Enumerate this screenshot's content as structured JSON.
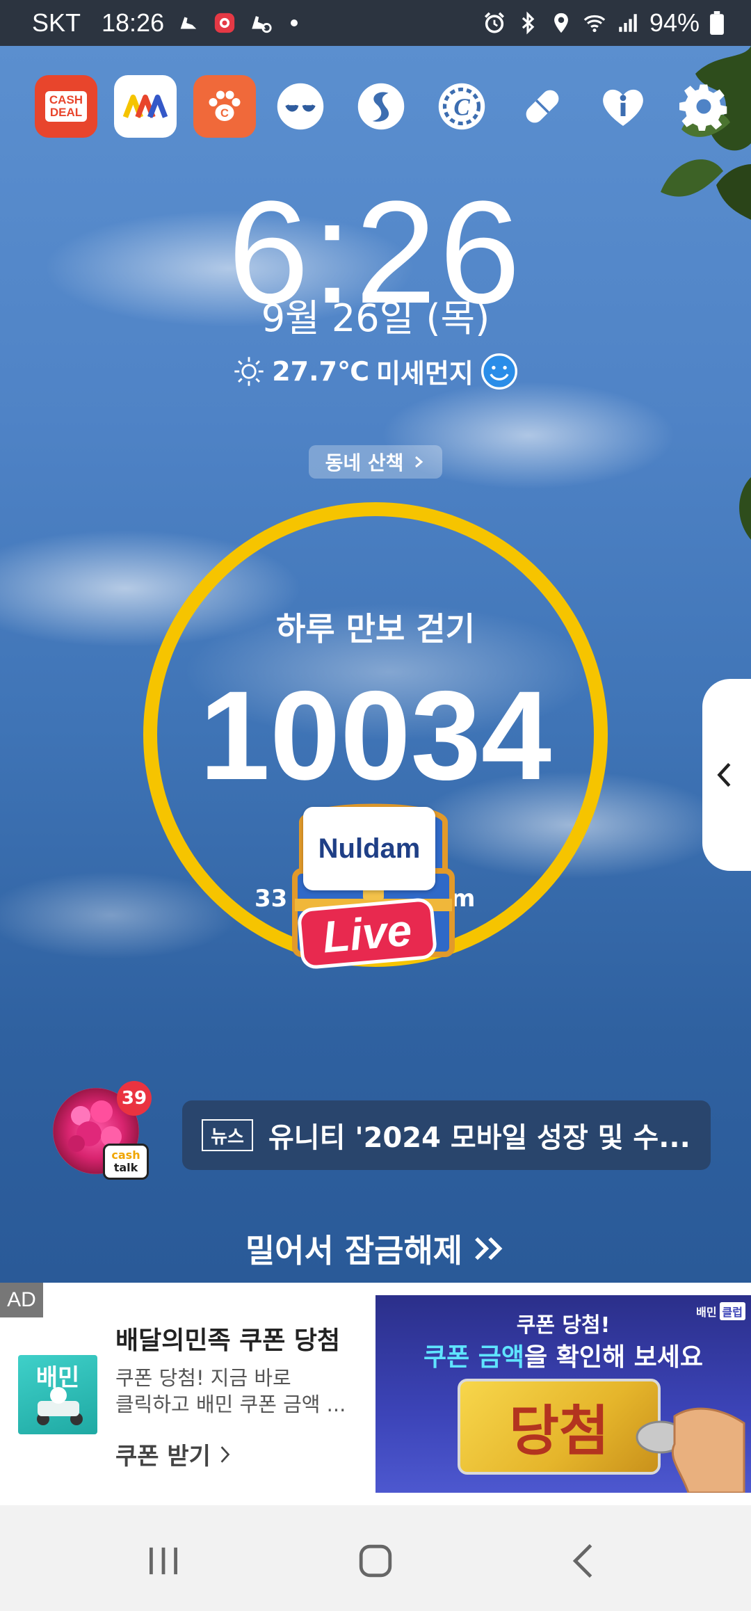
{
  "status_bar": {
    "carrier": "SKT",
    "time": "18:26",
    "battery": "94%"
  },
  "apps": [
    {
      "name": "cash-deal",
      "label": "CASH\nDEAL",
      "color": "#e8452c"
    },
    {
      "name": "app-m",
      "color": "#ffffff"
    },
    {
      "name": "pet-app",
      "color": "#f0693a"
    },
    {
      "name": "eyes-app",
      "color": "#ffffff"
    },
    {
      "name": "s-app",
      "color": "#ffffff"
    },
    {
      "name": "c-coin-app",
      "color": "#ffffff"
    },
    {
      "name": "pill-app",
      "color": "#ffffff"
    },
    {
      "name": "heart-info-app",
      "color": "#ffffff"
    },
    {
      "name": "settings-app",
      "color": "#ffffff"
    }
  ],
  "cash_deal_lines": [
    "CASH",
    "DEAL"
  ],
  "clock": "6:26",
  "date": "9월 26일 (목)",
  "weather": {
    "temp": "27.7℃",
    "dust_label": "미세먼지"
  },
  "walk_pill": "동네 산책",
  "steps": {
    "title": "하루 만보 걷기",
    "count": "10034",
    "distance_prefix": "33",
    "distance_suffix": "m"
  },
  "widget": {
    "brand": "Nuldam",
    "badge": "Live"
  },
  "cashtalk": {
    "badge_count": "39",
    "bubble_line1": "cash",
    "bubble_line2": "talk"
  },
  "news": {
    "tag": "뉴스",
    "headline": "유니티 '2024 모바일 성장 및 수..."
  },
  "unlock_text": "밀어서 잠금해제",
  "ad": {
    "label": "AD",
    "logo_text": "배민",
    "title": "배달의민족 쿠폰 당첨",
    "desc_line1": "쿠폰 당첨! 지금 바로",
    "desc_line2": "클릭하고 배민 쿠폰 금액 ...",
    "cta": "쿠폰 받기",
    "banner_badge_1": "배민",
    "banner_badge_2": "클럽",
    "banner_line1": "쿠폰 당첨!",
    "banner_line2_hl": "쿠폰 금액",
    "banner_line2_rest": "을 확인해 보세요",
    "banner_ticket": "당첨"
  },
  "colors": {
    "ring": "#f6c400",
    "live": "#e8294f",
    "badge": "#ea3340"
  }
}
